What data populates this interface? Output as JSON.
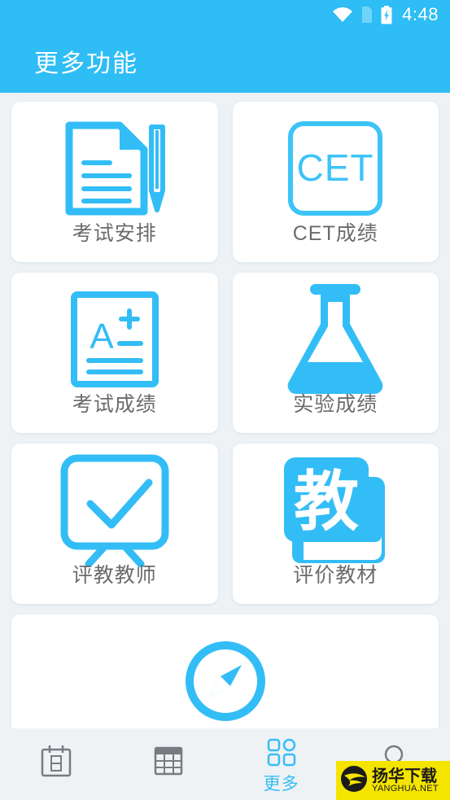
{
  "statusbar": {
    "wifi_icon": "wifi-icon",
    "sim_icon": "sim-card-icon",
    "battery_icon": "battery-charging-icon",
    "time": "4:48"
  },
  "appbar": {
    "title": "更多功能"
  },
  "grid": {
    "rows": [
      [
        {
          "label": "考试安排",
          "icon": "document-pencil-icon"
        },
        {
          "label": "CET成绩",
          "icon": "cet-square-icon",
          "icon_text": "CET"
        }
      ],
      [
        {
          "label": "考试成绩",
          "icon": "grade-paper-icon",
          "icon_text": "A+"
        },
        {
          "label": "实验成绩",
          "icon": "flask-icon"
        }
      ],
      [
        {
          "label": "评教教师",
          "icon": "checkboard-icon"
        },
        {
          "label": "评价教材",
          "icon": "textbook-icon",
          "icon_text": "教"
        }
      ],
      [
        {
          "label": "",
          "icon": "compass-icon"
        }
      ]
    ]
  },
  "bottomnav": {
    "items": [
      {
        "label": "",
        "icon": "calendar-icon",
        "active": false
      },
      {
        "label": "",
        "icon": "table-grid-icon",
        "active": false
      },
      {
        "label": "更多",
        "icon": "apps-grid-icon",
        "active": true
      },
      {
        "label": "",
        "icon": "person-icon",
        "active": false
      }
    ]
  },
  "watermark": {
    "cn": "扬华下载",
    "en": "YANGHUA.NET"
  },
  "colors": {
    "accent": "#2ebdf5",
    "page_bg": "#eef2f5",
    "card_bg": "#ffffff",
    "label_gray": "#6b6b6b",
    "nav_gray": "#787c80",
    "watermark_bg": "#f5e400"
  }
}
